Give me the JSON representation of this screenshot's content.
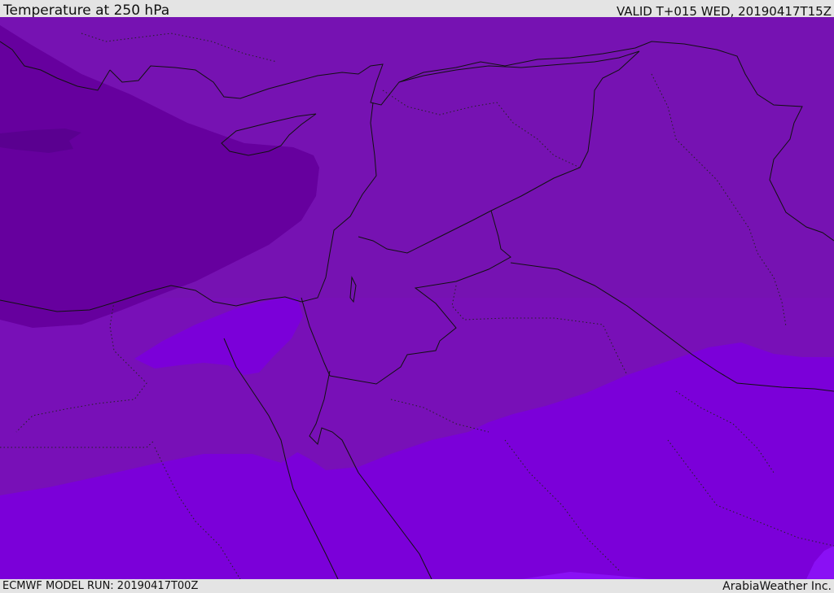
{
  "header": {
    "title": "Temperature at 250 hPa",
    "valid": "VALID T+015 WED, 20190417T15Z"
  },
  "footer": {
    "model_run": "ECMWF MODEL RUN: 20190417T00Z",
    "credit": "ArabiaWeather Inc."
  },
  "colors": {
    "band_coldest": "#5a0090",
    "band_cold": "#66009e",
    "band_mid": "#7612b2",
    "band_mid_south": "#7a0ebc",
    "band_warm": "#7b00d9",
    "band_warmest": "#8a10f4",
    "boundary_line": "#111111"
  }
}
